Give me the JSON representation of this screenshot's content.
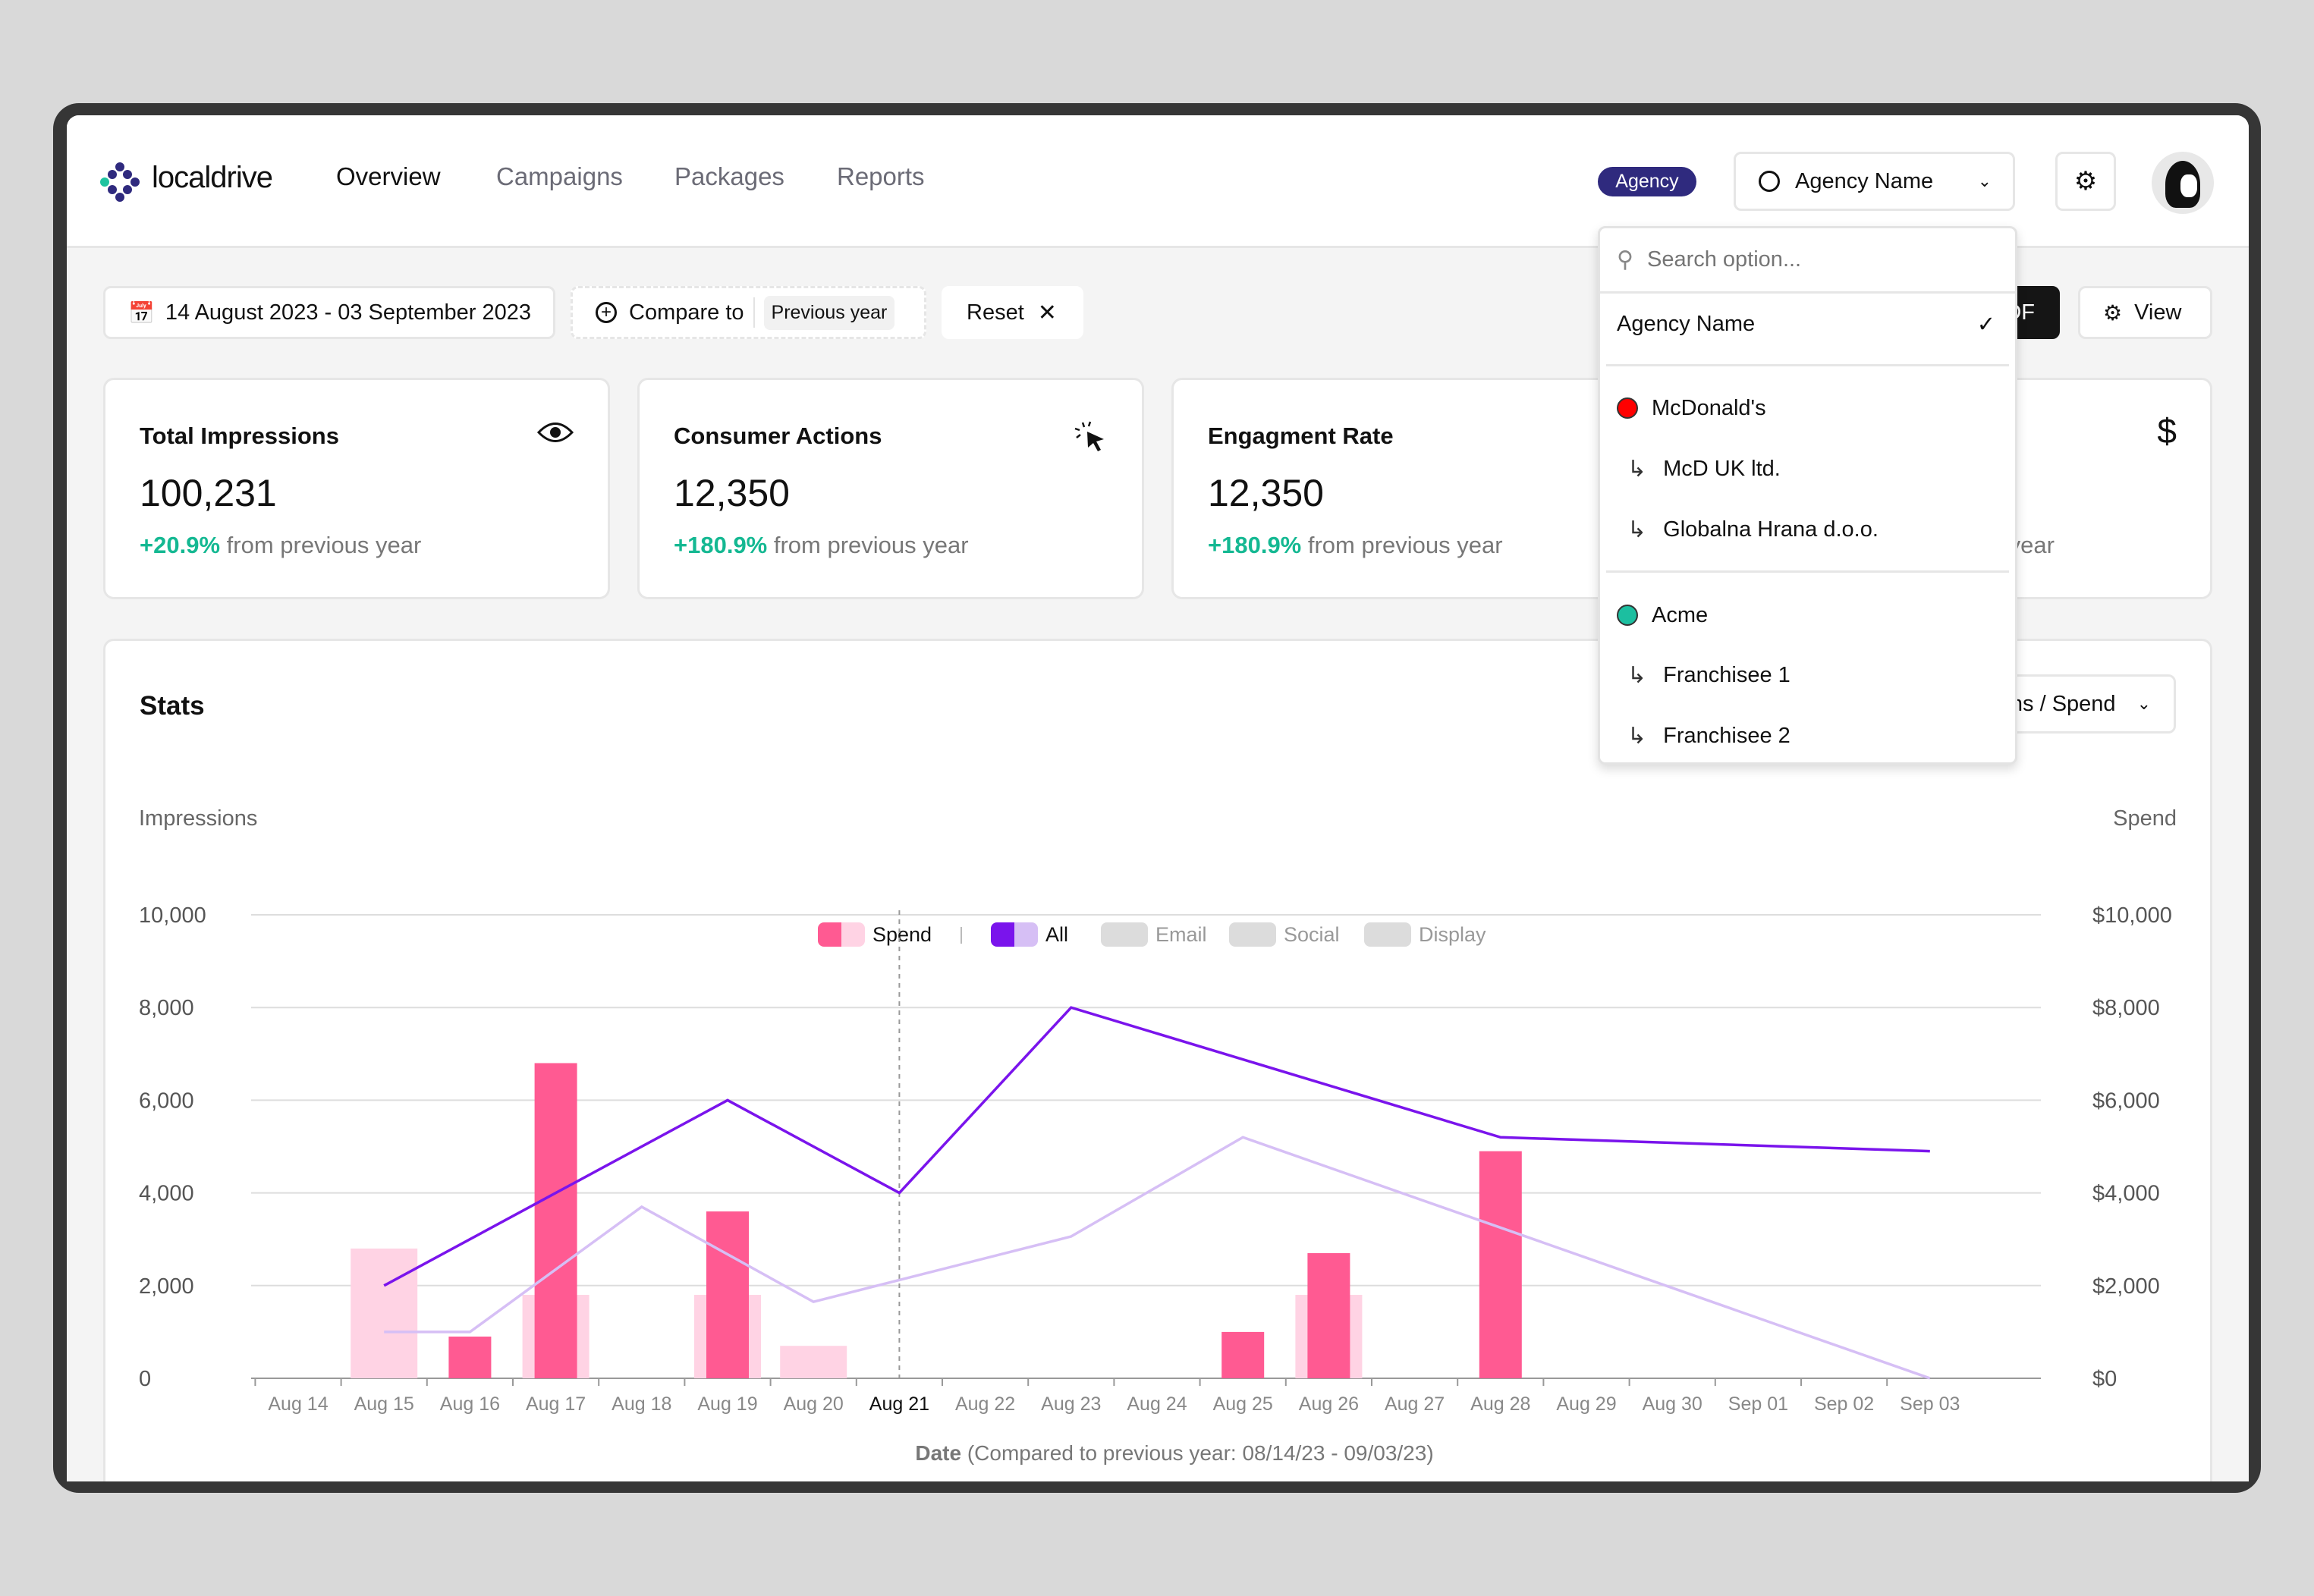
{
  "header": {
    "brand": "localdrive",
    "nav": [
      "Overview",
      "Campaigns",
      "Packages",
      "Reports"
    ],
    "badge": "Agency",
    "account_select": "Agency Name",
    "colors": {
      "badge": "#2f2a7e",
      "logo_accent": "#1fc3a0"
    }
  },
  "toolbar": {
    "date_range": "14 August 2023 - 03 September 2023",
    "compare_label": "Compare to",
    "compare_value": "Previous year",
    "reset": "Reset",
    "export": "PDF",
    "view": "View"
  },
  "cards": [
    {
      "title": "Total Impressions",
      "value": "100,231",
      "delta": "+20.9%",
      "delta_text": "from previous year",
      "icon": "eye-icon"
    },
    {
      "title": "Consumer Actions",
      "value": "12,350",
      "delta": "+180.9%",
      "delta_text": "from previous year",
      "icon": "cursor-click-icon"
    },
    {
      "title": "Engagment Rate",
      "value": "12,350",
      "delta": "+180.9%",
      "delta_text": "from previous year"
    },
    {
      "delta_text": "from previous year",
      "icon": "dollar-icon"
    }
  ],
  "stats": {
    "title": "Stats",
    "metric_select": "Impressions / Spend",
    "left_axis": "Impressions",
    "right_axis": "Spend",
    "legend": [
      {
        "label": "Spend",
        "active": true,
        "colors": [
          "#ff5a92",
          "#ffd3e4"
        ]
      },
      {
        "label": "All",
        "active": true,
        "colors": [
          "#7a14ec",
          "#d6bff5"
        ]
      },
      {
        "label": "Email",
        "active": false
      },
      {
        "label": "Social",
        "active": false
      },
      {
        "label": "Display",
        "active": false
      }
    ],
    "x_title_bold": "Date",
    "x_title_rest": "(Compared to previous year: 08/14/23 - 09/03/23)"
  },
  "dropdown": {
    "search_placeholder": "Search option...",
    "selected": "Agency Name",
    "groups": [
      {
        "name": "McDonald's",
        "color": "#ff0000",
        "children": [
          "McD UK ltd.",
          "Globalna Hrana d.o.o."
        ]
      },
      {
        "name": "Acme",
        "color": "#1cbfa0",
        "children": [
          "Franchisee 1",
          "Franchisee 2"
        ]
      }
    ]
  },
  "chart_data": {
    "type": "bar+line",
    "categories": [
      "Aug 14",
      "Aug 15",
      "Aug 16",
      "Aug 17",
      "Aug 18",
      "Aug 19",
      "Aug 20",
      "Aug 21",
      "Aug 22",
      "Aug 23",
      "Aug 24",
      "Aug 25",
      "Aug 26",
      "Aug 27",
      "Aug 28",
      "Aug 29",
      "Aug 30",
      "Sep 01",
      "Sep 02",
      "Sep 03"
    ],
    "highlight": "Aug 21",
    "ylim": [
      0,
      10000
    ],
    "yticks": [
      "0",
      "2,000",
      "4,000",
      "6,000",
      "8,000",
      "10,000"
    ],
    "y2ticks": [
      "$0",
      "$2,000",
      "$4,000",
      "$6,000",
      "$8,000",
      "$10,000"
    ],
    "spend_current": {
      "Aug 16": 900,
      "Aug 17": 6800,
      "Aug 19": 3600,
      "Aug 25": 1000,
      "Aug 26": 2700,
      "Aug 28": 4900
    },
    "spend_previous": {
      "Aug 15": 2800,
      "Aug 17": 1800,
      "Aug 19": 1800,
      "Aug 20": 700,
      "Aug 26": 1800
    },
    "impressions_current": [
      [
        "Aug 15",
        2000
      ],
      [
        "Aug 17",
        4000
      ],
      [
        "Aug 19",
        6000
      ],
      [
        "Aug 21",
        4000
      ],
      [
        "Aug 23",
        8000
      ],
      [
        "Aug 28",
        5200
      ],
      [
        "Sep 03",
        4900
      ]
    ],
    "impressions_previous": [
      [
        "Aug 15",
        1000
      ],
      [
        "Aug 16",
        1000
      ],
      [
        "Aug 18",
        3700
      ],
      [
        "Aug 20",
        1650
      ],
      [
        "Aug 23",
        3060
      ],
      [
        "Aug 25",
        5200
      ],
      [
        "Sep 03",
        0
      ]
    ],
    "colors": {
      "spend_current": "#ff5a92",
      "spend_previous": "#ffd3e4",
      "all_current": "#7a14ec",
      "all_previous": "#d6bff5"
    }
  }
}
